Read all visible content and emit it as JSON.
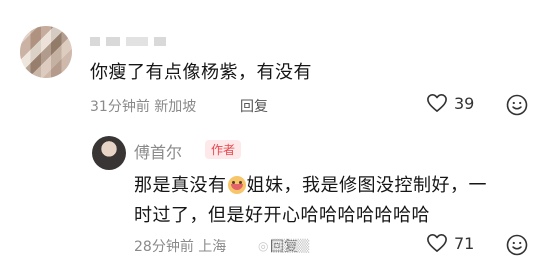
{
  "comment": {
    "text": "你瘦了有点像杨紫，有没有",
    "time": "31分钟前",
    "location": "新加坡",
    "reply_label": "回复",
    "likes": "39"
  },
  "reply": {
    "author": "傅首尔",
    "badge": "作者",
    "text_before_emoji": "那是真没有",
    "text_after_emoji": "姐妹，我是修图没控制好，一",
    "text_line2": "时过了，但是好开心哈哈哈哈哈哈哈",
    "time": "28分钟前",
    "location": "上海",
    "reply_label": "回复",
    "likes": "71"
  },
  "icons": {
    "like": "heart-outline-icon",
    "emoji": "smiley-outline-icon"
  },
  "colors": {
    "author_badge_text": "#e9474f",
    "author_badge_bg": "#fde9ea",
    "meta_gray": "#8a8a8a"
  }
}
